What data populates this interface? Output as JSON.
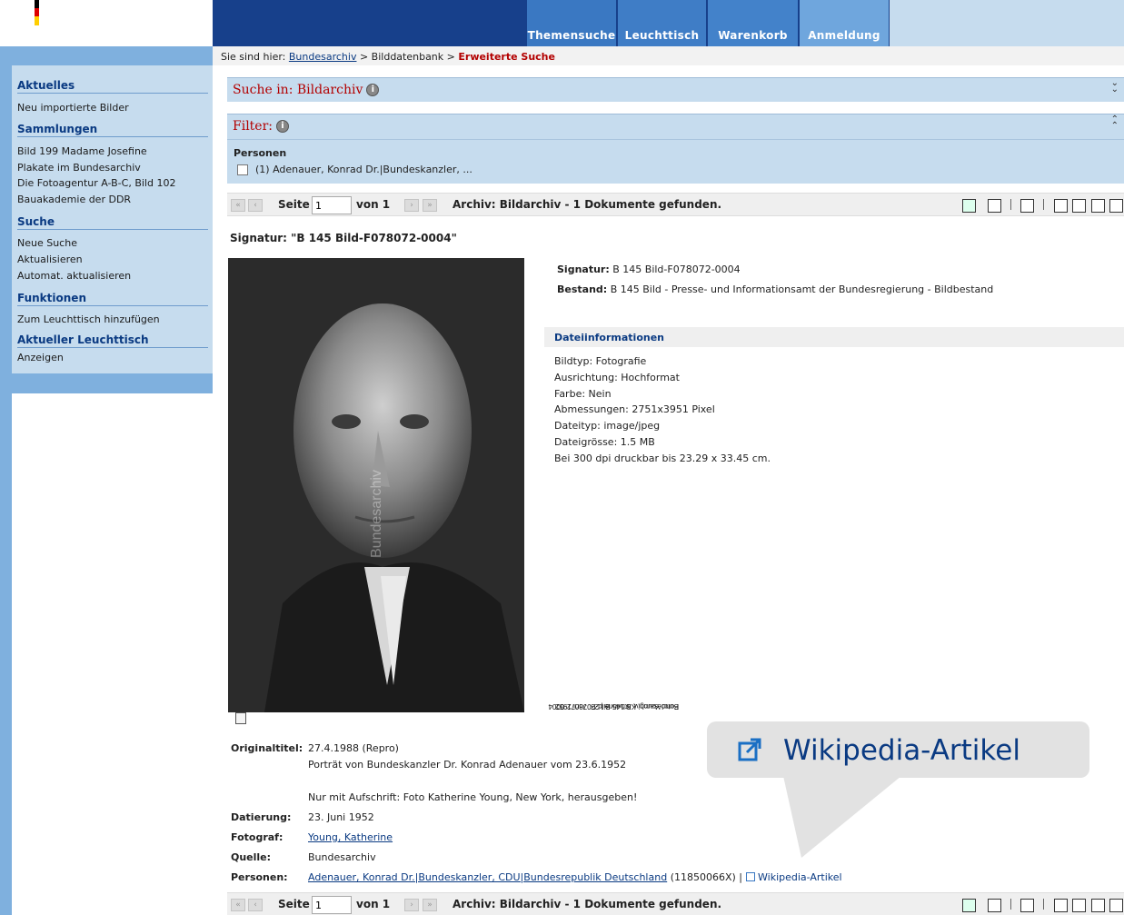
{
  "header": {
    "nav_tabs": [
      "Themensuche",
      "Leuchttisch",
      "Warenkorb",
      "Anmeldung"
    ]
  },
  "breadcrumb": {
    "prefix": "Sie sind hier:",
    "items": [
      "Bundesarchiv",
      "Bilddatenbank"
    ],
    "separator": ">",
    "current": "Erweiterte Suche"
  },
  "sidebar": {
    "sections": [
      {
        "title": "Aktuelles",
        "items": [
          "Neu importierte Bilder"
        ]
      },
      {
        "title": "Sammlungen",
        "items": [
          "Bild 199 Madame Josefine",
          "Plakate im Bundesarchiv",
          "Die Fotoagentur A-B-C, Bild 102",
          "Bauakademie der DDR"
        ]
      },
      {
        "title": "Suche",
        "items": [
          "Neue Suche",
          "Aktualisieren",
          "Automat. aktualisieren"
        ]
      },
      {
        "title": "Funktionen",
        "items": [
          "Zum Leuchttisch hinzufügen"
        ]
      },
      {
        "title": "Aktueller Leuchttisch",
        "items": [
          "Anzeigen"
        ]
      }
    ]
  },
  "search_panel": {
    "title": "Suche in: Bildarchiv",
    "info": "i"
  },
  "filter_panel": {
    "title": "Filter:",
    "info": "i",
    "group_label": "Personen",
    "option_label": "(1) Adenauer, Konrad Dr.|Bundeskanzler, ..."
  },
  "pager": {
    "page_label": "Seite",
    "page_value": "1",
    "of_label": "von 1",
    "status": "Archiv: Bildarchiv - 1 Dokumente gefunden.",
    "first": "«",
    "prev": "‹",
    "next": "›",
    "last": "»"
  },
  "record": {
    "signatur_heading": "Signatur: \"B 145 Bild-F078072-0004\"",
    "signatur_label": "Signatur:",
    "signatur_value": "B 145 Bild-F078072-0004",
    "bestand_label": "Bestand:",
    "bestand_value": "B 145 Bild - Presse- und Informationsamt der Bundesregierung - Bildbestand",
    "photo_credit_line1": "Bundesarchiv, B 145 Bild-F078072-0004",
    "photo_credit_line2": "Foto: Young, Katherine | 23. Juni 1952",
    "watermark": "Bundesarchiv"
  },
  "file_info": {
    "heading": "Dateiinformationen",
    "lines": [
      "Bildtyp: Fotografie",
      "Ausrichtung: Hochformat",
      "Farbe: Nein",
      "Abmessungen: 2751x3951 Pixel",
      "Dateityp: image/jpeg",
      "Dateigrösse: 1.5 MB",
      "Bei 300 dpi druckbar bis 23.29 x 33.45 cm."
    ]
  },
  "metadata": {
    "originaltitel_label": "Originaltitel:",
    "originaltitel_lines": [
      "27.4.1988 (Repro)",
      "Porträt von Bundeskanzler Dr. Konrad Adenauer vom 23.6.1952",
      "Nur mit Aufschrift: Foto Katherine Young, New York, herausgeben!"
    ],
    "datierung_label": "Datierung:",
    "datierung_value": "23. Juni 1952",
    "fotograf_label": "Fotograf:",
    "fotograf_value": "Young, Katherine",
    "quelle_label": "Quelle:",
    "quelle_value": "Bundesarchiv",
    "personen_label": "Personen:",
    "personen_link": "Adenauer, Konrad Dr.|Bundeskanzler, CDU|Bundesrepublik Deutschland",
    "personen_id": "(11850066X)",
    "personen_sep": "|",
    "wikipedia_link": "Wikipedia-Artikel"
  },
  "callout": {
    "text": "Wikipedia-Artikel",
    "icon": "external-link-icon"
  },
  "colors": {
    "header_blue": "#17408b",
    "tab_blue": "#3f7dc6",
    "tab_light": "#6fa6dd",
    "sidebar_bg": "#c6dcee",
    "accent_red": "#b30000",
    "link_blue": "#0a3a82"
  }
}
